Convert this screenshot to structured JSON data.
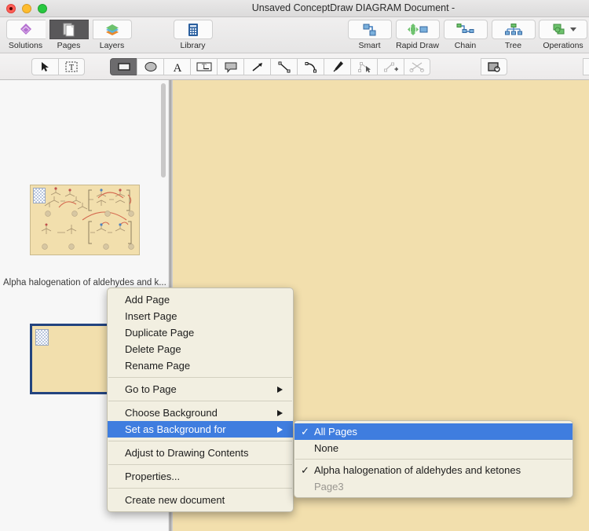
{
  "window": {
    "title": "Unsaved ConceptDraw DIAGRAM Document -",
    "traffic_lights": [
      "close-button",
      "minimize-button",
      "zoom-button"
    ]
  },
  "main_toolbar": {
    "left_group": [
      {
        "label": "Solutions",
        "icon": "solutions-diamond-icon",
        "active": false
      },
      {
        "label": "Pages",
        "icon": "pages-stack-icon",
        "active": true
      },
      {
        "label": "Layers",
        "icon": "layers-books-icon",
        "active": false
      }
    ],
    "library_group": [
      {
        "label": "Library",
        "icon": "library-grid-icon",
        "active": false
      }
    ],
    "right_group": [
      {
        "label": "Smart",
        "icon": "smart-connector-icon"
      },
      {
        "label": "Rapid Draw",
        "icon": "rapid-draw-icon"
      },
      {
        "label": "Chain",
        "icon": "chain-icon"
      },
      {
        "label": "Tree",
        "icon": "tree-icon"
      },
      {
        "label": "Operations",
        "icon": "operations-shape-icon",
        "has_dropdown": true
      }
    ]
  },
  "draw_toolbar": {
    "select_group": [
      {
        "icon": "arrow-pointer-icon",
        "active": false
      },
      {
        "icon": "text-select-icon",
        "active": false
      }
    ],
    "shape_group": [
      {
        "icon": "rectangle-icon",
        "active": true
      },
      {
        "icon": "ellipse-icon",
        "active": false
      },
      {
        "icon": "text-letter-icon",
        "active": false
      },
      {
        "icon": "text-box-icon",
        "active": false
      },
      {
        "icon": "callout-icon",
        "active": false
      },
      {
        "icon": "arrow-line-icon",
        "active": false
      },
      {
        "icon": "straight-line-icon",
        "active": false
      },
      {
        "icon": "curve-line-icon",
        "active": false
      },
      {
        "icon": "pen-icon",
        "active": false
      },
      {
        "icon": "edit-points-icon",
        "active": false,
        "disabled": true
      },
      {
        "icon": "add-point-icon",
        "active": false,
        "disabled": true
      },
      {
        "icon": "cut-path-icon",
        "active": false,
        "disabled": true
      }
    ],
    "last_group": [
      {
        "icon": "hyperlink-icon",
        "active": false
      }
    ],
    "edge_group": [
      {
        "icon": "partial-tool-icon",
        "active": false
      }
    ]
  },
  "sidebar": {
    "pages": [
      {
        "name": "page-thumbnail-1",
        "caption": "Alpha halogenation of aldehydes and k...",
        "selected": false,
        "has_content": true
      },
      {
        "name": "page-thumbnail-2",
        "caption": "",
        "selected": true,
        "has_content": false
      }
    ]
  },
  "context_menu": {
    "groups": [
      {
        "items": [
          {
            "label": "Add Page",
            "submenu": false,
            "highlighted": false
          },
          {
            "label": "Insert Page",
            "submenu": false,
            "highlighted": false
          },
          {
            "label": "Duplicate Page",
            "submenu": false,
            "highlighted": false
          },
          {
            "label": "Delete Page",
            "submenu": false,
            "highlighted": false
          },
          {
            "label": "Rename Page",
            "submenu": false,
            "highlighted": false
          }
        ]
      },
      {
        "items": [
          {
            "label": "Go to Page",
            "submenu": true,
            "highlighted": false
          }
        ]
      },
      {
        "items": [
          {
            "label": "Choose Background",
            "submenu": true,
            "highlighted": false
          },
          {
            "label": "Set as Background for",
            "submenu": true,
            "highlighted": true
          }
        ]
      },
      {
        "items": [
          {
            "label": "Adjust to Drawing Contents",
            "submenu": false,
            "highlighted": false
          }
        ]
      },
      {
        "items": [
          {
            "label": "Properties...",
            "submenu": false,
            "highlighted": false
          }
        ]
      },
      {
        "items": [
          {
            "label": "Create new document",
            "submenu": false,
            "highlighted": false
          }
        ]
      }
    ]
  },
  "submenu": {
    "groups": [
      {
        "items": [
          {
            "label": "All Pages",
            "checked": true,
            "highlighted": true,
            "muted": false
          },
          {
            "label": "None",
            "checked": false,
            "highlighted": false,
            "muted": false
          }
        ]
      },
      {
        "items": [
          {
            "label": "Alpha halogenation of aldehydes and ketones",
            "checked": true,
            "highlighted": false,
            "muted": false
          },
          {
            "label": "Page3",
            "checked": false,
            "highlighted": false,
            "muted": true
          }
        ]
      }
    ]
  },
  "colors": {
    "canvas": "#f2dfad",
    "menu_background": "#f2efe1",
    "highlight": "#3f7ddf",
    "selection_border": "#23447f",
    "toolbar_active": "#59585a"
  }
}
